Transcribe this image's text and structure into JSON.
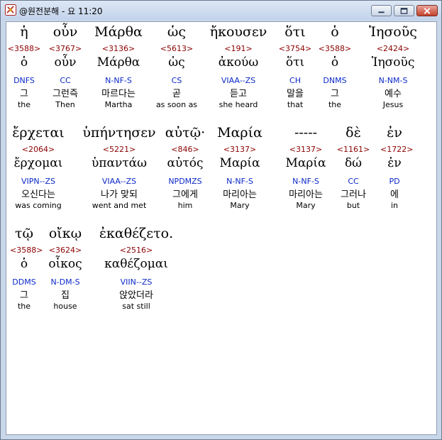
{
  "window": {
    "title": "@원전분해 - 요 11:20",
    "buttons": {
      "minimize": "minimize",
      "maximize": "maximize",
      "close": "close"
    }
  },
  "colors": {
    "strongs": "#8b0000",
    "parsing": "#0b28c8",
    "text": "#000000"
  },
  "words": [
    {
      "greek": "ἡ",
      "strongs": "<3588>",
      "lemma": "ὁ",
      "parsing": "DNFS",
      "korean": "그",
      "english": "the"
    },
    {
      "greek": "οὖν",
      "strongs": "<3767>",
      "lemma": "οὖν",
      "parsing": "CC",
      "korean": "그런즉",
      "english": "Then"
    },
    {
      "greek": "Μάρθα",
      "strongs": "<3136>",
      "lemma": "Μάρθα",
      "parsing": "N-NF-S",
      "korean": "마르다는",
      "english": "Martha"
    },
    {
      "greek": "ὡς",
      "strongs": "<5613>",
      "lemma": "ὡς",
      "parsing": "CS",
      "korean": "곧",
      "english": "as soon as"
    },
    {
      "greek": "ἤκουσεν",
      "strongs": "<191>",
      "lemma": "ἀκούω",
      "parsing": "VIAA--ZS",
      "korean": "듣고",
      "english": "she heard"
    },
    {
      "greek": "ὅτι",
      "strongs": "<3754>",
      "lemma": "ὅτι",
      "parsing": "CH",
      "korean": "말을",
      "english": "that"
    },
    {
      "greek": "ὁ",
      "strongs": "<3588>",
      "lemma": "ὁ",
      "parsing": "DNMS",
      "korean": "그",
      "english": "the"
    },
    {
      "greek": "Ἰησοῦς",
      "strongs": "<2424>",
      "lemma": "Ἰησοῦς",
      "parsing": "N-NM-S",
      "korean": "예수",
      "english": "Jesus"
    },
    {
      "greek": "ἔρχεται",
      "strongs": "<2064>",
      "lemma": "ἔρχομαι",
      "parsing": "VIPN--ZS",
      "korean": "오신다는",
      "english": "was coming"
    },
    {
      "greek": "ὑπήντησεν",
      "strongs": "<5221>",
      "lemma": "ὑπαντάω",
      "parsing": "VIAA--ZS",
      "korean": "나가 맞되",
      "english": "went and met"
    },
    {
      "greek": "αὐτῷ·",
      "strongs": "<846>",
      "lemma": "αὐτός",
      "parsing": "NPDMZS",
      "korean": "그에게",
      "english": "him"
    },
    {
      "greek": "Μαρία",
      "strongs": "<3137>",
      "lemma": "Μαρία",
      "parsing": "N-NF-S",
      "korean": "마리아는",
      "english": "Mary"
    },
    {
      "greek": "-----",
      "strongs": "<3137>",
      "lemma": "Μαρία",
      "parsing": "N-NF-S",
      "korean": "마리아는",
      "english": "Mary"
    },
    {
      "greek": "δὲ",
      "strongs": "<1161>",
      "lemma": "δώ",
      "parsing": "CC",
      "korean": "그러나",
      "english": "but"
    },
    {
      "greek": "ἐν",
      "strongs": "<1722>",
      "lemma": "ἐν",
      "parsing": "PD",
      "korean": "에",
      "english": "in"
    },
    {
      "greek": "τῷ",
      "strongs": "<3588>",
      "lemma": "ὁ",
      "parsing": "DDMS",
      "korean": "그",
      "english": "the"
    },
    {
      "greek": "οἴκῳ",
      "strongs": "<3624>",
      "lemma": "οἶκος",
      "parsing": "N-DM-S",
      "korean": "집",
      "english": "house"
    },
    {
      "greek": "ἐκαθέζετο.",
      "strongs": "<2516>",
      "lemma": "καθέζομαι",
      "parsing": "VIIN--ZS",
      "korean": "앉았더라",
      "english": "sat still"
    }
  ]
}
